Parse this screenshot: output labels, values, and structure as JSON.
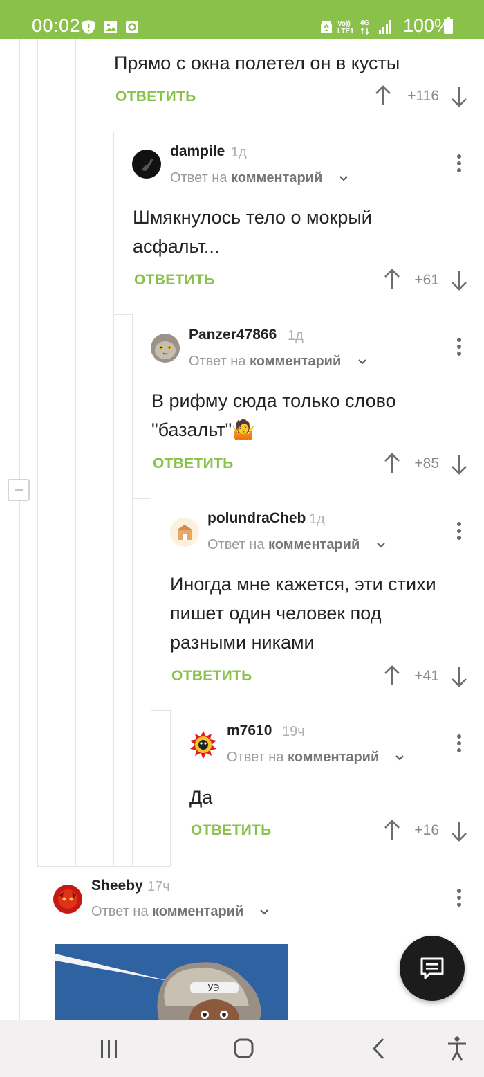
{
  "status_bar": {
    "time": "00:02",
    "battery": "100%",
    "volte_top": "Vo))",
    "volte_bottom": "LTE1",
    "network": "4G"
  },
  "comments": [
    {
      "text": "Прямо с окна полетел он в кусты",
      "reply": "ОТВЕТИТЬ",
      "score": "+116"
    },
    {
      "author": "dampile",
      "age": "1д",
      "reply_prefix": "Ответ на",
      "reply_link": "комментарий",
      "text": "Шмякнулось тело о мокрый асфальт...",
      "reply": "ОТВЕТИТЬ",
      "score": "+61"
    },
    {
      "author": "Panzer47866",
      "age": "1д",
      "reply_prefix": "Ответ на",
      "reply_link": "комментарий",
      "text": "В рифму сюда только слово \"базальт\"🤷",
      "reply": "ОТВЕТИТЬ",
      "score": "+85"
    },
    {
      "author": "polundraCheb",
      "age": "1д",
      "reply_prefix": "Ответ на",
      "reply_link": "комментарий",
      "text": "Иногда мне кажется, эти стихи пишет один человек под разными никами",
      "reply": "ОТВЕТИТЬ",
      "score": "+41"
    },
    {
      "author": "m7610",
      "age": "19ч",
      "reply_prefix": "Ответ на",
      "reply_link": "комментарий",
      "text": "Да",
      "reply": "ОТВЕТИТЬ",
      "score": "+16"
    },
    {
      "author": "Sheeby",
      "age": "17ч",
      "reply_prefix": "Ответ на",
      "reply_link": "комментарий"
    }
  ],
  "image_caption": "УЭ",
  "colors": {
    "accent": "#8ac14a",
    "status_bar": "#8ac14a",
    "fab": "#1c1c1c"
  },
  "icons": [
    "shield-icon",
    "image-icon",
    "app-icon",
    "recycle-icon",
    "signal-icon",
    "battery-icon",
    "arrow-up-icon",
    "arrow-down-icon",
    "more-vert-icon",
    "chevron-down-icon",
    "comment-icon",
    "recents-icon",
    "home-icon",
    "back-icon",
    "accessibility-icon"
  ]
}
